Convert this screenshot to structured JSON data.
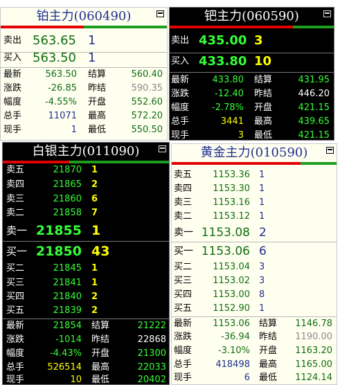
{
  "pt": {
    "title": "铂主力(060490)",
    "sell": {
      "label": "卖出",
      "price": "563.65",
      "vol": "1"
    },
    "buy": {
      "label": "买入",
      "price": "563.50",
      "vol": "1"
    },
    "stats": [
      {
        "l1": "最新",
        "v1": "563.50",
        "l2": "结算",
        "v2": "560.40"
      },
      {
        "l1": "涨跌",
        "v1": "-26.85",
        "l2": "昨结",
        "v2": "590.35"
      },
      {
        "l1": "幅度",
        "v1": "-4.55%",
        "l2": "开盘",
        "v2": "552.60"
      },
      {
        "l1": "总手",
        "v1": "11071",
        "l2": "最高",
        "v2": "572.20"
      },
      {
        "l1": "现手",
        "v1": "1",
        "l2": "最低",
        "v2": "550.50"
      }
    ]
  },
  "pd": {
    "title": "钯主力(060590)",
    "sell": {
      "label": "卖出",
      "price": "435.00",
      "vol": "3"
    },
    "buy": {
      "label": "买入",
      "price": "433.80",
      "vol": "10"
    },
    "stats": [
      {
        "l1": "最新",
        "v1": "433.80",
        "l2": "结算",
        "v2": "431.95"
      },
      {
        "l1": "涨跌",
        "v1": "-12.40",
        "l2": "昨结",
        "v2": "446.20"
      },
      {
        "l1": "幅度",
        "v1": "-2.78%",
        "l2": "开盘",
        "v2": "421.15"
      },
      {
        "l1": "总手",
        "v1": "3441",
        "l2": "最高",
        "v2": "439.65"
      },
      {
        "l1": "现手",
        "v1": "3",
        "l2": "最低",
        "v2": "421.15"
      }
    ]
  },
  "ag": {
    "title": "白银主力(011090)",
    "asks": [
      {
        "label": "卖五",
        "price": "21870",
        "vol": "1"
      },
      {
        "label": "卖四",
        "price": "21865",
        "vol": "2"
      },
      {
        "label": "卖三",
        "price": "21860",
        "vol": "6"
      },
      {
        "label": "卖二",
        "price": "21858",
        "vol": "7"
      },
      {
        "label": "卖一",
        "price": "21855",
        "vol": "1"
      }
    ],
    "bids": [
      {
        "label": "买一",
        "price": "21850",
        "vol": "43"
      },
      {
        "label": "买二",
        "price": "21845",
        "vol": "1"
      },
      {
        "label": "买三",
        "price": "21841",
        "vol": "1"
      },
      {
        "label": "买四",
        "price": "21840",
        "vol": "2"
      },
      {
        "label": "买五",
        "price": "21839",
        "vol": "2"
      }
    ],
    "stats": [
      {
        "l1": "最新",
        "v1": "21854",
        "l2": "结算",
        "v2": "21222"
      },
      {
        "l1": "涨跌",
        "v1": "-1014",
        "l2": "昨结",
        "v2": "22868"
      },
      {
        "l1": "幅度",
        "v1": "-4.43%",
        "l2": "开盘",
        "v2": "21300"
      },
      {
        "l1": "总手",
        "v1": "526514",
        "l2": "最高",
        "v2": "22033"
      },
      {
        "l1": "现手",
        "v1": "10",
        "l2": "最低",
        "v2": "20402"
      }
    ]
  },
  "au": {
    "title": "黄金主力(010590)",
    "asks": [
      {
        "label": "卖五",
        "price": "1153.36",
        "vol": "1"
      },
      {
        "label": "卖四",
        "price": "1153.30",
        "vol": "1"
      },
      {
        "label": "卖三",
        "price": "1153.16",
        "vol": "1"
      },
      {
        "label": "卖二",
        "price": "1153.12",
        "vol": "1"
      },
      {
        "label": "卖一",
        "price": "1153.08",
        "vol": "2"
      }
    ],
    "bids": [
      {
        "label": "买一",
        "price": "1153.06",
        "vol": "6"
      },
      {
        "label": "买二",
        "price": "1153.04",
        "vol": "3"
      },
      {
        "label": "买三",
        "price": "1153.02",
        "vol": "3"
      },
      {
        "label": "买四",
        "price": "1153.00",
        "vol": "8"
      },
      {
        "label": "买五",
        "price": "1152.90",
        "vol": "1"
      }
    ],
    "stats": [
      {
        "l1": "最新",
        "v1": "1153.06",
        "l2": "结算",
        "v2": "1146.78"
      },
      {
        "l1": "涨跌",
        "v1": "-36.94",
        "l2": "昨结",
        "v2": "1190.00"
      },
      {
        "l1": "幅度",
        "v1": "-3.10%",
        "l2": "开盘",
        "v2": "1163.20"
      },
      {
        "l1": "总手",
        "v1": "418498",
        "l2": "最高",
        "v2": "1165.00"
      },
      {
        "l1": "现手",
        "v1": "6",
        "l2": "最低",
        "v2": "1124.14"
      }
    ]
  },
  "colors": {
    "up_green": "#36ff36",
    "dark_vol": "#ffff00",
    "light_title": "#1f2f8f",
    "bar_red": "#e30000",
    "bar_green": "#1d9e1d"
  },
  "icons": {
    "window_button": "restore-window-icon"
  }
}
